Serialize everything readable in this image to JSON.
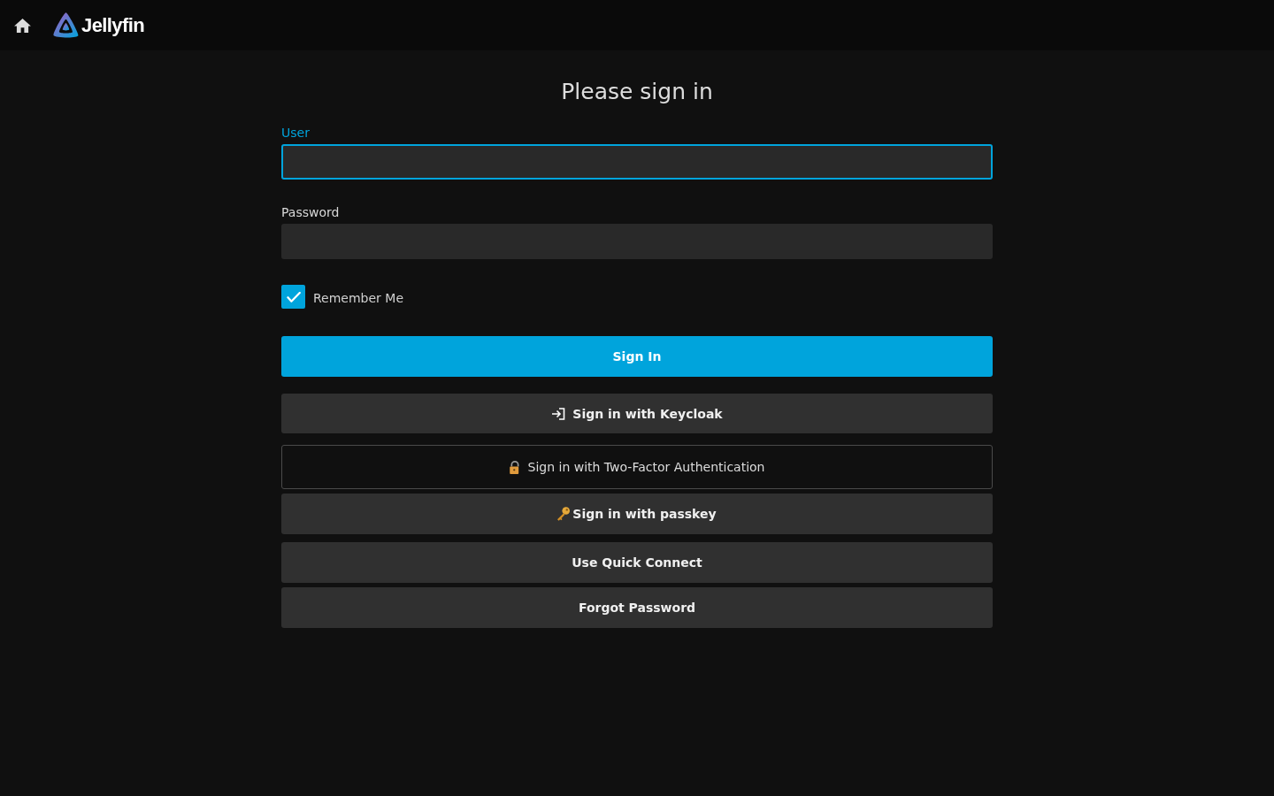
{
  "header": {
    "brand": "Jellyfin"
  },
  "title": "Please sign in",
  "fields": [
    {
      "label": "User",
      "focused": true
    },
    {
      "label": "Password",
      "focused": false
    }
  ],
  "remember": {
    "label": "Remember Me",
    "checked": true
  },
  "buttons": [
    {
      "label": "Sign In",
      "kind": "primary"
    },
    {
      "label": "Sign in with Keycloak",
      "kind": "sso"
    },
    {
      "label": "Sign in with Two-Factor Authentication",
      "kind": "twofactor"
    },
    {
      "label": "Sign in with passkey",
      "kind": "passkey"
    },
    {
      "label": "Use Quick Connect",
      "kind": "plain"
    },
    {
      "label": "Forgot Password",
      "kind": "plain"
    }
  ]
}
